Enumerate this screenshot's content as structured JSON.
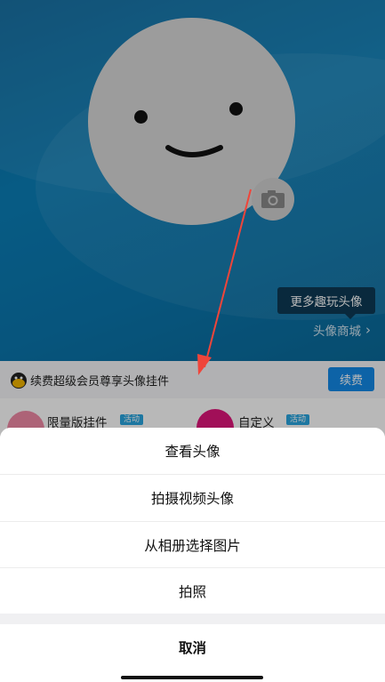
{
  "avatar_section": {
    "tooltip_text": "更多趣玩头像",
    "mall_link_label": "头像商城",
    "mall_link_chevron": "›"
  },
  "vip_row": {
    "text": "续费超级会员尊享头像挂件",
    "renew_button_label": "续费"
  },
  "pendant_row": {
    "items": [
      {
        "label": "限量版挂件",
        "badge": "活动"
      },
      {
        "label": "自定义",
        "badge": "活动"
      }
    ]
  },
  "action_sheet": {
    "options": [
      {
        "label": "查看头像"
      },
      {
        "label": "拍摄视频头像"
      },
      {
        "label": "从相册选择图片"
      },
      {
        "label": "拍照"
      }
    ],
    "cancel_label": "取消"
  },
  "colors": {
    "accent": "#1289e8",
    "annotation_arrow": "#f0453a"
  },
  "icons": [
    "camera-icon",
    "vip-crown-icon",
    "chevron-right-icon"
  ]
}
